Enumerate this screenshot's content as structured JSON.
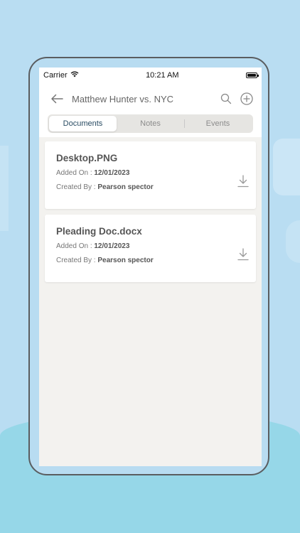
{
  "status": {
    "carrier": "Carrier",
    "time": "10:21 AM"
  },
  "header": {
    "title": "Matthew Hunter vs. NYC"
  },
  "tabs": [
    {
      "label": "Documents",
      "active": true
    },
    {
      "label": "Notes",
      "active": false
    },
    {
      "label": "Events",
      "active": false
    }
  ],
  "documents": [
    {
      "name": "Desktop.PNG",
      "added_label": "Added On : ",
      "added_value": "12/01/2023",
      "created_label": "Created By : ",
      "created_value": "Pearson spector"
    },
    {
      "name": "Pleading Doc.docx",
      "added_label": "Added On : ",
      "added_value": "12/01/2023",
      "created_label": "Created By : ",
      "created_value": "Pearson spector"
    }
  ],
  "colors": {
    "background": "#b9ddf2",
    "screen": "#f3f2ef",
    "active_tab_text": "#2a4c63"
  }
}
